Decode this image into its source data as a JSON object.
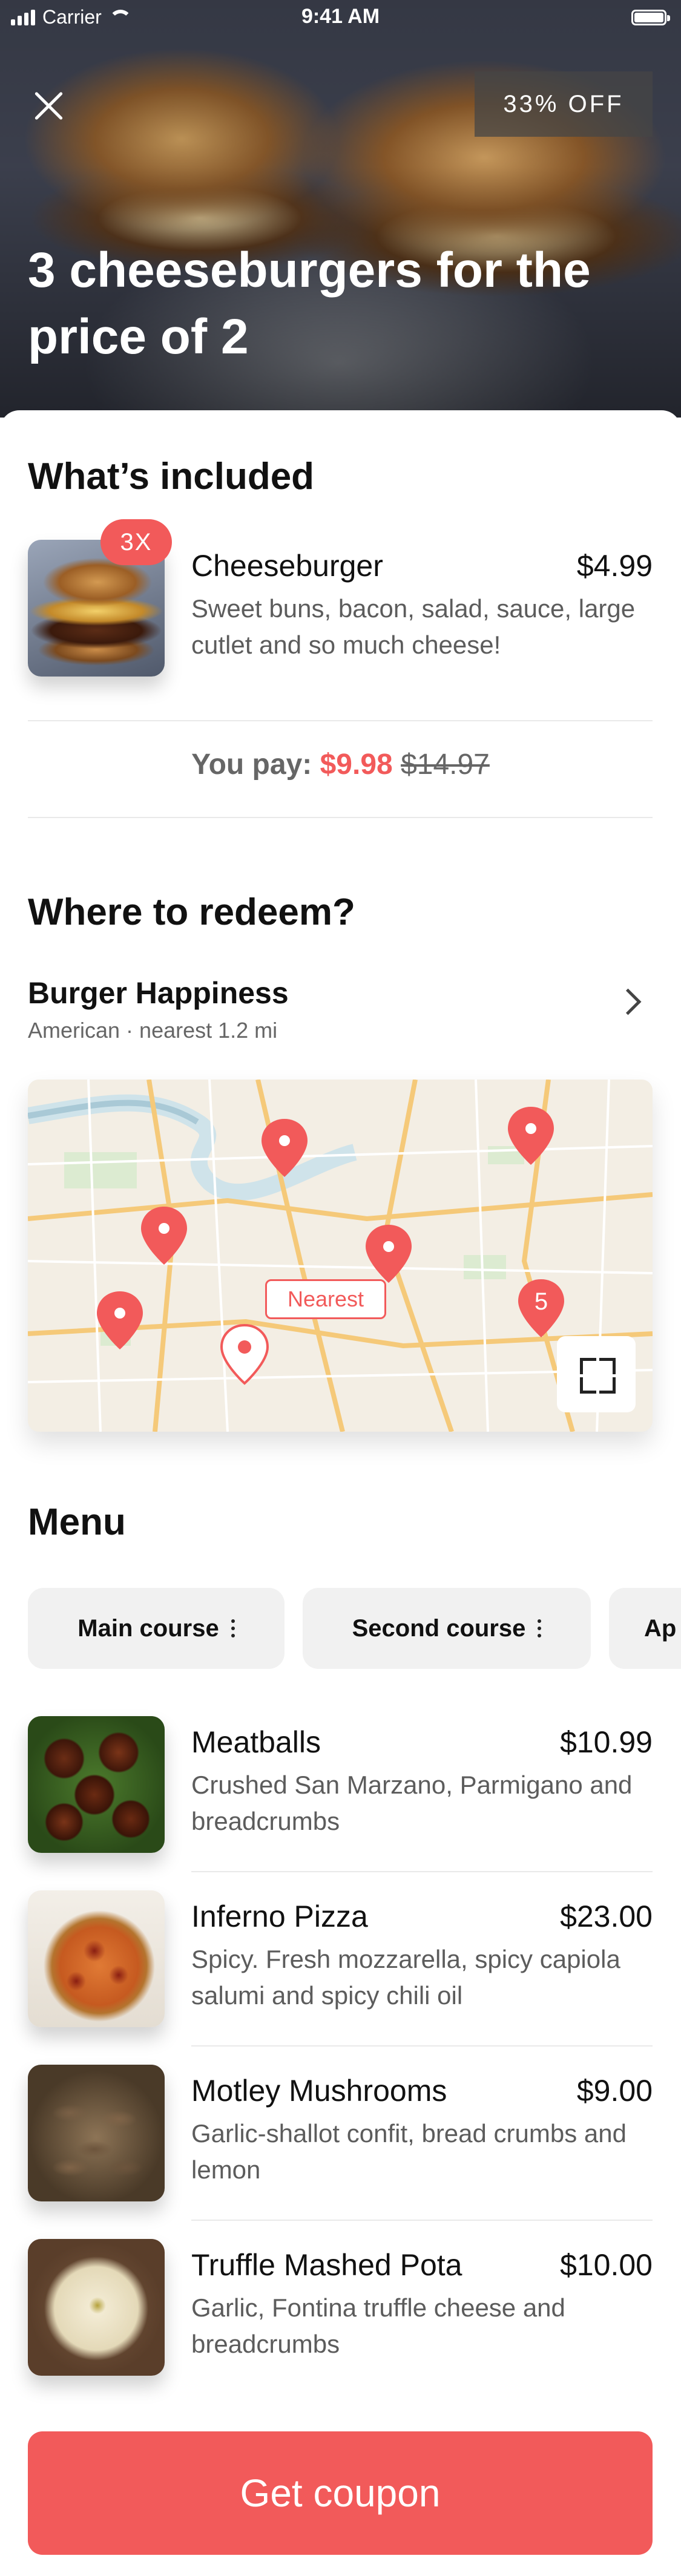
{
  "status_bar": {
    "carrier": "Carrier",
    "time": "9:41 AM"
  },
  "hero": {
    "discount_badge": "33% OFF",
    "title": "3 cheeseburgers for the price of 2"
  },
  "included": {
    "heading": "What’s included",
    "item": {
      "quantity_badge": "3X",
      "name": "Cheeseburger",
      "price": "$4.99",
      "description": "Sweet buns, bacon, salad, sauce, large cutlet and so much cheese!"
    },
    "pay": {
      "label": "You pay:",
      "price": "$9.98",
      "old_price": "$14.97"
    }
  },
  "redeem": {
    "heading": "Where to redeem?",
    "restaurant_name": "Burger Happiness",
    "restaurant_meta": "American · nearest 1.2 mi",
    "map": {
      "nearest_label": "Nearest",
      "cluster_count": "5"
    }
  },
  "menu": {
    "heading": "Menu",
    "tabs": [
      "Main course",
      "Second course",
      "Ap"
    ],
    "items": [
      {
        "name": "Meatballs",
        "price": "$10.99",
        "description": "Crushed San Marzano, Parmigano and breadcrumbs"
      },
      {
        "name": "Inferno Pizza",
        "price": "$23.00",
        "description": "Spicy. Fresh mozzarella, spicy capiola salumi and spicy chili oil"
      },
      {
        "name": "Motley Mushrooms",
        "price": "$9.00",
        "description": "Garlic-shallot confit, bread crumbs and lemon"
      },
      {
        "name": "Truffle Mashed Pota",
        "price": "$10.00",
        "description": "Garlic, Fontina truffle cheese and breadcrumbs"
      }
    ]
  },
  "cta": {
    "label": "Get coupon"
  },
  "colors": {
    "accent": "#f25a5a",
    "text": "#111111",
    "muted": "#5c5c5c"
  }
}
